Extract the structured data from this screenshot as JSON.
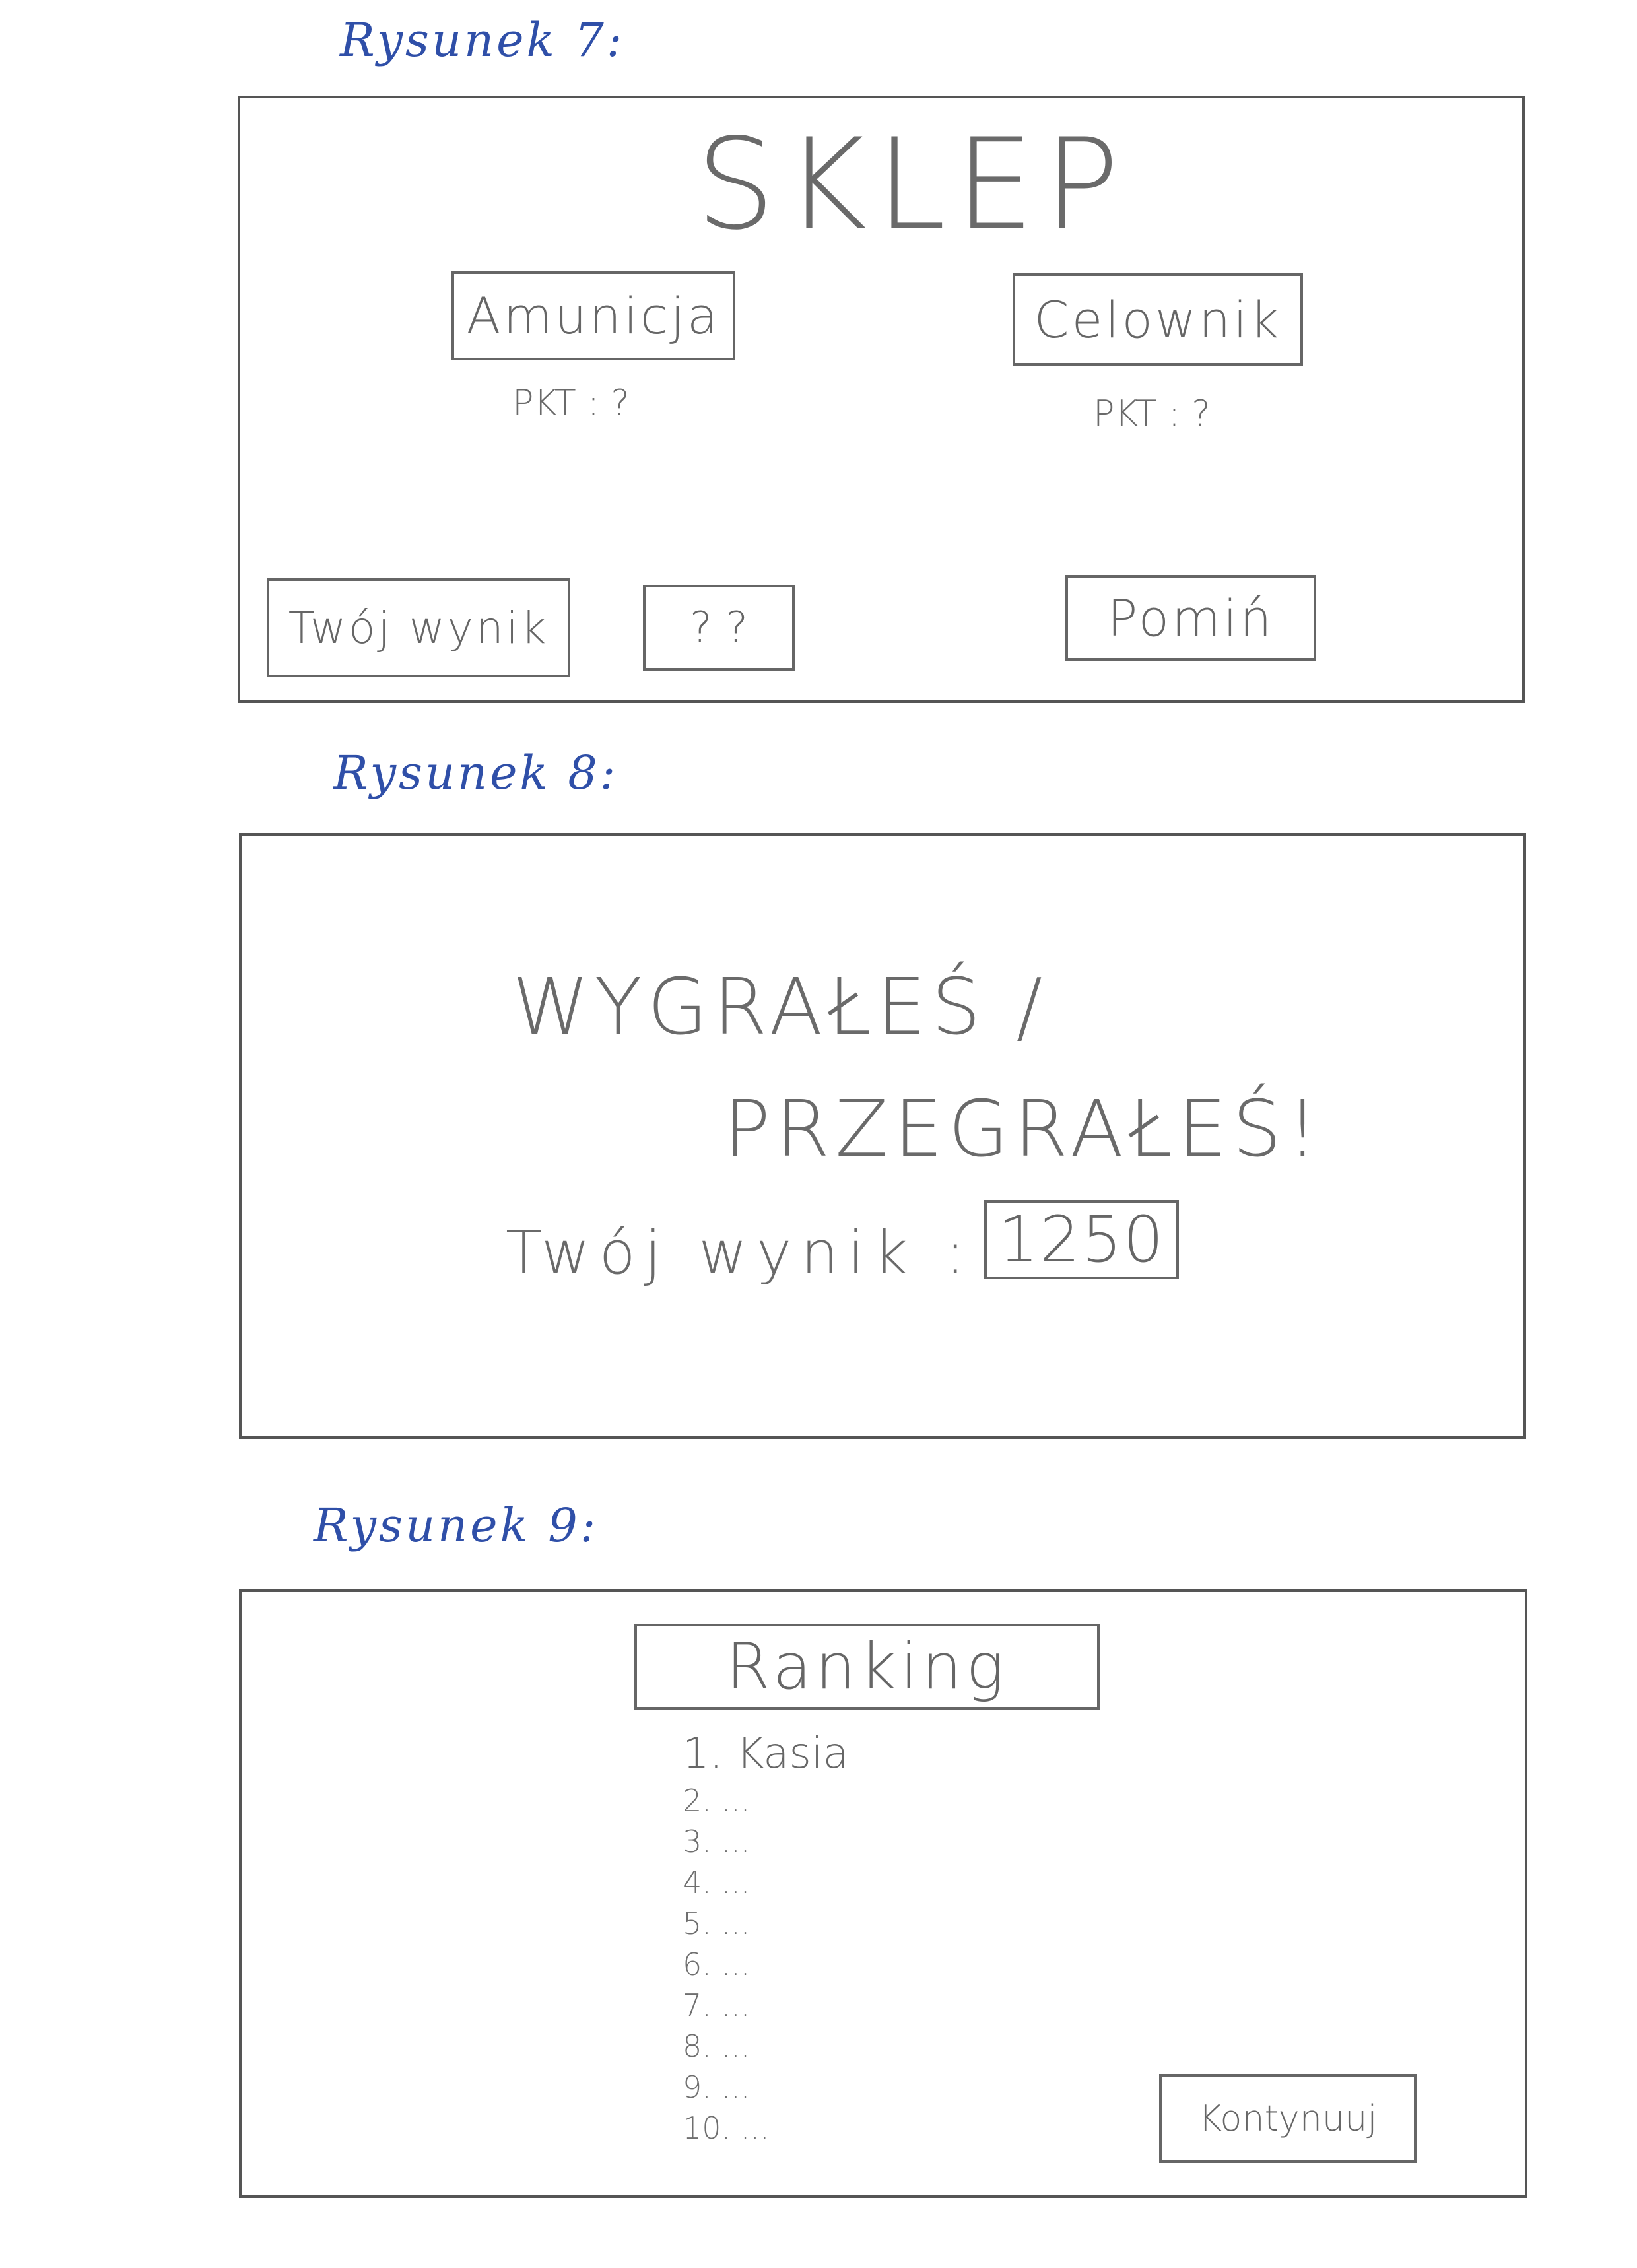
{
  "figures": [
    {
      "caption": "Rysunek 7:",
      "title": "SKLEP",
      "items": [
        {
          "label": "Amunicja",
          "points": "PKT : ?"
        },
        {
          "label": "Celownik",
          "points": "PKT : ?"
        }
      ],
      "score_button": "Twój wynik",
      "score_value": "? ?",
      "skip_button": "Pomiń"
    },
    {
      "caption": "Rysunek 8:",
      "result_line1": "WYGRAŁEŚ /",
      "result_line2": "PRZEGRAŁEŚ!",
      "score_label": "Twój wynik :",
      "score_value": "1250"
    },
    {
      "caption": "Rysunek 9:",
      "title": "Ranking",
      "entries": [
        "1. Kasia",
        "2. ...",
        "3. ...",
        "4. ...",
        "5. ...",
        "6. ...",
        "7. ...",
        "8. ...",
        "9. ...",
        "10. ..."
      ],
      "continue_button": "Kontynuuj"
    }
  ]
}
